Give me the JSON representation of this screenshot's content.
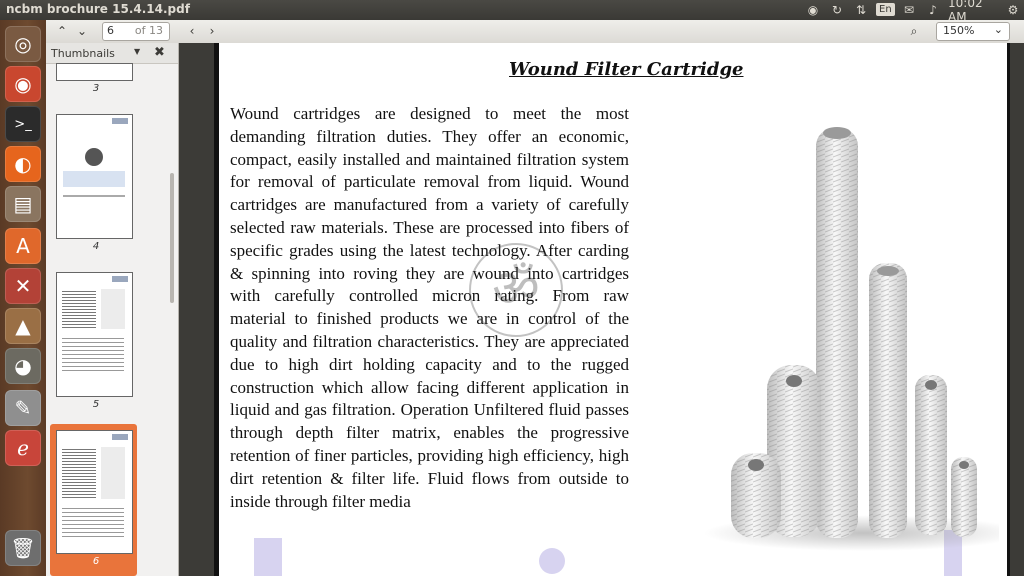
{
  "window": {
    "title": "ncbm brochure 15.4.14.pdf"
  },
  "tray": {
    "lang": "En",
    "time": "10:02 AM"
  },
  "launcher": {
    "items": [
      {
        "name": "ubuntu-dash-icon",
        "glyph": "◎",
        "bg": "#7a5a42"
      },
      {
        "name": "chrome-icon",
        "glyph": "◉",
        "bg": "#c9472f"
      },
      {
        "name": "terminal-icon",
        "glyph": ">_",
        "bg": "#2b2b2b"
      },
      {
        "name": "firefox-icon",
        "glyph": "◐",
        "bg": "#e6651d"
      },
      {
        "name": "files-icon",
        "glyph": "▤",
        "bg": "#8a7560"
      },
      {
        "name": "software-center-icon",
        "glyph": "A",
        "bg": "#e0682b"
      },
      {
        "name": "settings-icon",
        "glyph": "✕",
        "bg": "#b34237"
      },
      {
        "name": "vlc-icon",
        "glyph": "▲",
        "bg": "#9a6f45"
      },
      {
        "name": "gimp-icon",
        "glyph": "◕",
        "bg": "#6c6a61"
      },
      {
        "name": "text-editor-icon",
        "glyph": "✎",
        "bg": "#8f8f8f"
      },
      {
        "name": "document-viewer-icon",
        "glyph": "ℯ",
        "bg": "#c8453a"
      },
      {
        "name": "trash-icon",
        "glyph": "🗑",
        "bg": "#6e6e6e"
      }
    ]
  },
  "toolbar": {
    "page_current": "6",
    "page_of": "of 13",
    "zoom": "150%"
  },
  "sidebar": {
    "title": "Thumbnails",
    "thumbs": [
      {
        "num": "3"
      },
      {
        "num": "4"
      },
      {
        "num": "5"
      },
      {
        "num": "6"
      }
    ]
  },
  "document": {
    "title": "Wound Filter Cartridge",
    "body": "Wound cartridges are designed to meet the most demanding filtration duties. They offer an economic, compact, easily installed and maintained filtration system for removal of particulate removal from liquid. Wound cartridges are manufactured from a variety of carefully selected raw materials. These are processed into fibers of specific grades using the latest technology. After carding & spinning into roving they are wound into cartridges with carefully controlled micron rating. From raw material to finished products we are in control of the quality and filtration characteristics. They are appreciated due to high dirt holding capacity and to the rugged construction which allow facing different application in liquid and gas filtration. Operation Unfiltered fluid passes through depth filter matrix, enables the progressive retention of finer particles, providing high efficiency, high dirt retention & filter life. Fluid flows from outside to inside through filter media"
  }
}
